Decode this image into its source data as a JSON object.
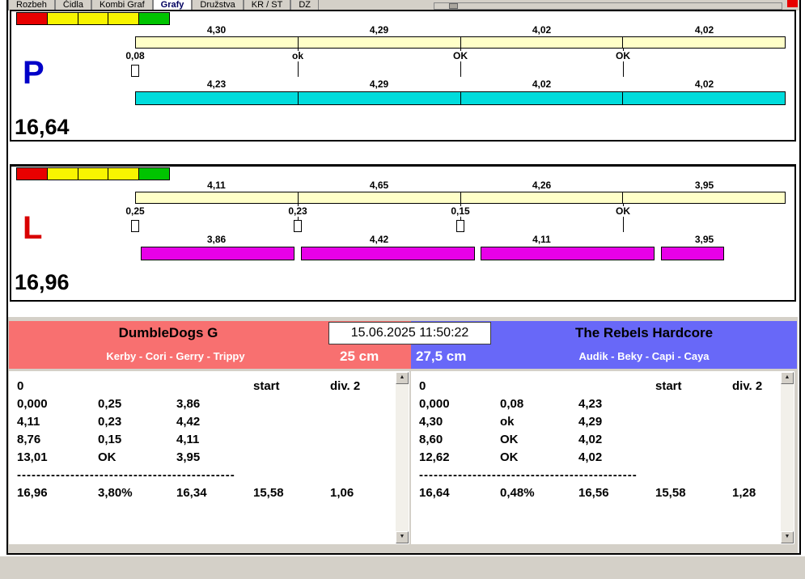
{
  "colors": {
    "chrome": "#d4d0c8",
    "cream": "#ffffc8",
    "cyan": "#00dcdc",
    "magenta": "#e800e8",
    "light-red": "#e80000",
    "light-yellow": "#f8f400",
    "light-green": "#00c400",
    "lane-p": "#0000c8",
    "lane-l": "#d80000",
    "team-red": "#f87070",
    "team-blue": "#6868f8"
  },
  "tabs": [
    {
      "label": "Rozbeh",
      "active": false
    },
    {
      "label": "Čidla",
      "active": false
    },
    {
      "label": "Kombi Graf",
      "active": false
    },
    {
      "label": "Grafy",
      "active": true
    },
    {
      "label": "Družstva",
      "active": false
    },
    {
      "label": "KR / ST",
      "active": false
    },
    {
      "label": "DZ",
      "active": false
    }
  ],
  "timestamp": "15.06.2025 11:50:22",
  "panel_p": {
    "lane": "P",
    "total": "16,64",
    "lights": [
      "red",
      "yellow",
      "yellow",
      "yellow",
      "green"
    ],
    "sensor_times": [
      "4,30",
      "4,29",
      "4,02",
      "4,02"
    ],
    "markers": [
      {
        "label": "0,08",
        "style": "checkbox"
      },
      {
        "label": "ok",
        "style": "tick"
      },
      {
        "label": "OK",
        "style": "tick"
      },
      {
        "label": "OK",
        "style": "tick"
      }
    ],
    "run_times": [
      "4,23",
      "4,29",
      "4,02",
      "4,02"
    ]
  },
  "panel_l": {
    "lane": "L",
    "total": "16,96",
    "lights": [
      "red",
      "yellow",
      "yellow",
      "yellow",
      "green"
    ],
    "sensor_times": [
      "4,11",
      "4,65",
      "4,26",
      "3,95"
    ],
    "markers": [
      {
        "label": "0,25",
        "style": "checkbox"
      },
      {
        "label": "0,23",
        "style": "checkbox"
      },
      {
        "label": "0,15",
        "style": "checkbox"
      },
      {
        "label": "OK",
        "style": "tick"
      }
    ],
    "run_times": [
      "3,86",
      "4,42",
      "4,11",
      "3,95"
    ]
  },
  "team_left": {
    "name": "DumbleDogs G",
    "dogs": "Kerby - Cori - Gerry - Trippy",
    "height": "25 cm",
    "table": {
      "header": [
        "0",
        "start",
        "div. 2"
      ],
      "rows": [
        [
          "0,000",
          "0,25",
          "3,86"
        ],
        [
          "4,11",
          "0,23",
          "4,42"
        ],
        [
          "8,76",
          "0,15",
          "4,11"
        ],
        [
          "13,01",
          "OK",
          "3,95"
        ]
      ],
      "dashes": "---------------------------------------------",
      "totals": [
        "16,96",
        "3,80%",
        "16,34",
        "15,58",
        "1,06"
      ]
    }
  },
  "team_right": {
    "name": "The Rebels Hardcore",
    "dogs": "Audik - Beky - Capi - Caya",
    "height": "27,5 cm",
    "table": {
      "header": [
        "0",
        "start",
        "div. 2"
      ],
      "rows": [
        [
          "0,000",
          "0,08",
          "4,23"
        ],
        [
          "4,30",
          "ok",
          "4,29"
        ],
        [
          "8,60",
          "OK",
          "4,02"
        ],
        [
          "12,62",
          "OK",
          "4,02"
        ]
      ],
      "dashes": "---------------------------------------------",
      "totals": [
        "16,64",
        "0,48%",
        "16,56",
        "15,58",
        "1,28"
      ]
    }
  }
}
